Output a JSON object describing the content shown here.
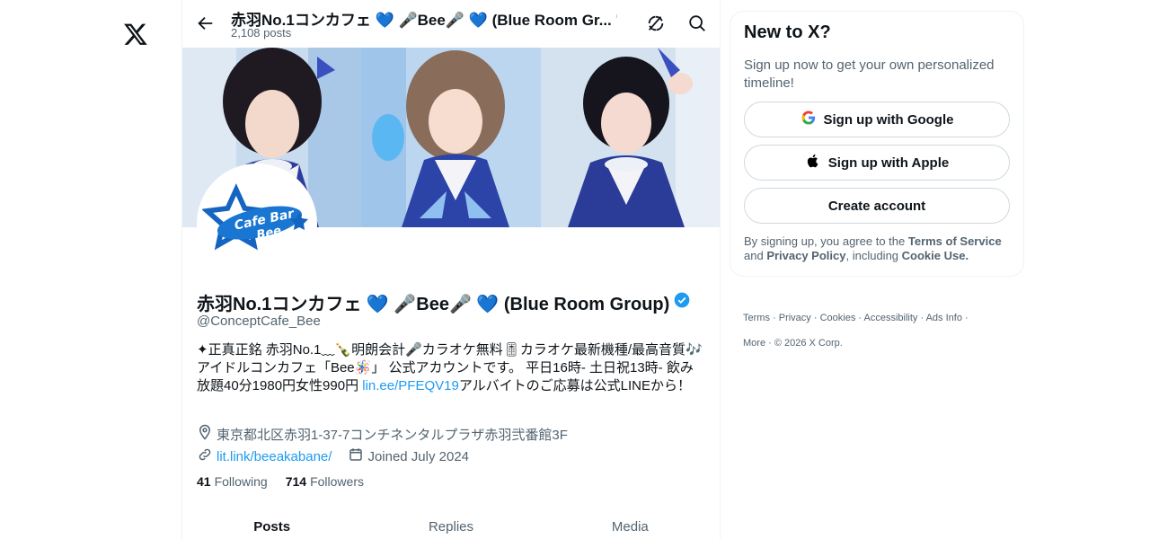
{
  "header": {
    "title": "赤羽No.1コンカフェ 💙 🎤Bee🎤 💙 (Blue Room Gr...",
    "post_count": "2,108 posts"
  },
  "profile": {
    "name": "赤羽No.1コンカフェ 💙 🎤Bee🎤 💙 (Blue Room Group)",
    "handle": "@ConceptCafe_Bee",
    "bio_part1": "✦正真正銘 赤羽No.1﹏🍾明朗会計🎤カラオケ無料🎚カラオケ最新機種/最高音質🎶アイドルコンカフェ「Bee🪅」 公式アカウントです。 平日16時- 土日祝13時- 飲み放題40分1980円女性990円 ",
    "bio_link": "lin.ee/PFEQV19",
    "bio_part2": "アルバイトのご応募は公式LINEから！",
    "location": "東京都北区赤羽1-37-7コンチネンタルプラザ赤羽弐番館3F",
    "website": "lit.link/beeakabane/",
    "joined": "Joined July 2024",
    "following_count": "41",
    "following_label": "Following",
    "followers_count": "714",
    "followers_label": "Followers",
    "avatar_logo_line1": "Cafe Bar",
    "avatar_logo_line2": "Bee"
  },
  "tabs": [
    "Posts",
    "Replies",
    "Media"
  ],
  "signup": {
    "title": "New to X?",
    "subtitle": "Sign up now to get your own personalized timeline!",
    "google_label": "Sign up with Google",
    "apple_label": "Sign up with Apple",
    "create_label": "Create account",
    "legal_prefix": "By signing up, you agree to the ",
    "terms_link": "Terms of Service",
    "legal_and": " and ",
    "privacy_link": "Privacy Policy",
    "legal_including": ", including ",
    "cookie_link": "Cookie Use."
  },
  "footer": {
    "links": [
      "Terms",
      "Privacy",
      "Cookies",
      "Accessibility",
      "Ads Info",
      "More"
    ],
    "copyright": "© 2026 X Corp."
  },
  "colors": {
    "accent": "#1d9bf0",
    "text": "#0f1419",
    "muted": "#536471",
    "verified": "#1d9bf0"
  },
  "icons": [
    "x-logo-icon",
    "back-arrow-icon",
    "verified-badge-icon",
    "refresh-icon",
    "search-icon",
    "location-icon",
    "link-icon",
    "calendar-icon",
    "google-icon",
    "apple-icon"
  ]
}
